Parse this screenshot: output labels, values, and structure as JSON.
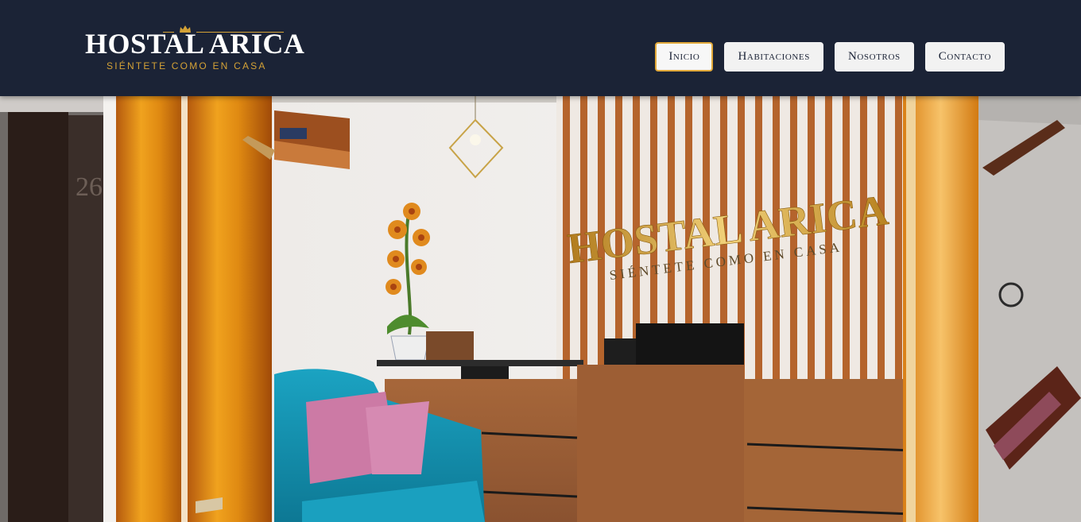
{
  "brand": {
    "name": "HOSTAL ARICA",
    "tagline": "SIÉNTETE COMO EN CASA",
    "accent_color": "#d4a236",
    "header_color": "#1b2336"
  },
  "nav": {
    "items": [
      {
        "label": "Inicio",
        "active": true
      },
      {
        "label": "Habitaciones",
        "active": false
      },
      {
        "label": "Nosotros",
        "active": false
      },
      {
        "label": "Contacto",
        "active": false
      }
    ]
  },
  "hero": {
    "image": "photo-hotel-reception",
    "wall_sign_title": "HOSTAL ARICA",
    "wall_sign_subtitle": "SIÉNTETE COMO EN CASA",
    "door_number": "26"
  }
}
